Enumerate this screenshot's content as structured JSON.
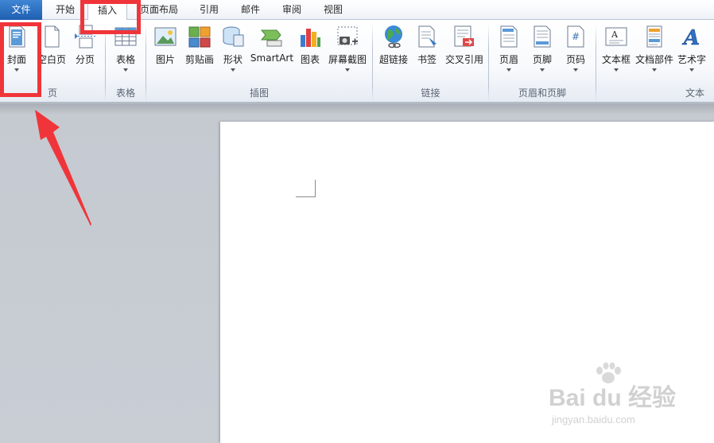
{
  "tabs": [
    {
      "id": "file",
      "label": "文件",
      "active": false
    },
    {
      "id": "home",
      "label": "开始",
      "active": false
    },
    {
      "id": "insert",
      "label": "插入",
      "active": true
    },
    {
      "id": "layout",
      "label": "页面布局",
      "active": false
    },
    {
      "id": "references",
      "label": "引用",
      "active": false
    },
    {
      "id": "mailings",
      "label": "邮件",
      "active": false
    },
    {
      "id": "review",
      "label": "审阅",
      "active": false
    },
    {
      "id": "view",
      "label": "视图",
      "active": false
    }
  ],
  "ribbon": {
    "groups": {
      "pages": "页",
      "tables": "表格",
      "illustrations": "插图",
      "links": "链接",
      "header_footer": "页眉和页脚",
      "text": "文本"
    },
    "buttons": {
      "cover": "封面",
      "blank_page": "空白页",
      "page_break": "分页",
      "table": "表格",
      "picture": "图片",
      "clip_art": "剪贴画",
      "shapes": "形状",
      "smartart": "SmartArt",
      "chart": "图表",
      "screenshot": "屏幕截图",
      "hyperlink": "超链接",
      "bookmark": "书签",
      "cross_reference": "交叉引用",
      "header": "页眉",
      "footer": "页脚",
      "page_number": "页码",
      "text_box": "文本框",
      "quick_parts": "文档部件",
      "wordart": "艺术字"
    }
  },
  "annotations": {
    "highlight_color": "#f0353a",
    "arrow_color": "#f0353a"
  },
  "watermark": {
    "brand": "Bai du 经验",
    "url": "jingyan.baidu.com"
  },
  "colors": {
    "file_tab": "#2b6fc2",
    "workspace": "#c7cbd2",
    "page": "#ffffff"
  }
}
